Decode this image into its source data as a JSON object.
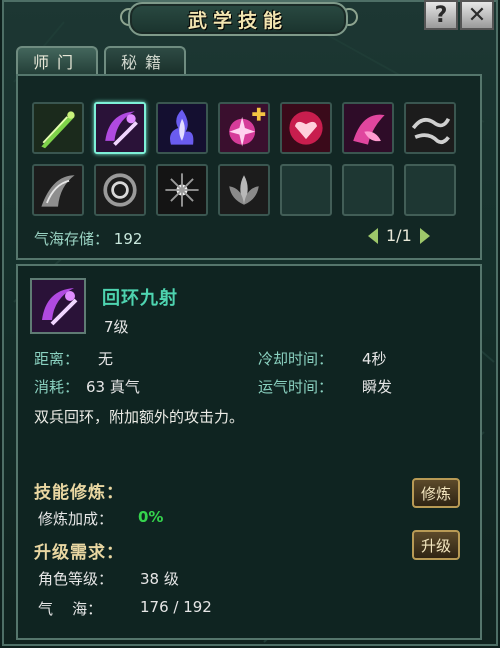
{
  "window": {
    "title": "武学技能",
    "help_label": "?",
    "close_label": "✕"
  },
  "tabs": [
    {
      "label": "师门",
      "active": true
    },
    {
      "label": "秘籍",
      "active": false
    }
  ],
  "skills": [
    {
      "icon": "green-blade-icon",
      "selected": false
    },
    {
      "icon": "purple-crescent-blade-icon",
      "selected": true
    },
    {
      "icon": "blue-purple-flame-icon",
      "selected": false
    },
    {
      "icon": "pink-star-burst-plus-icon",
      "selected": false
    },
    {
      "icon": "crimson-heart-shield-icon",
      "selected": false
    },
    {
      "icon": "magenta-petal-icon",
      "selected": false
    },
    {
      "icon": "grey-dragon-icon",
      "selected": false
    },
    {
      "icon": "grey-swirl-wing-icon",
      "selected": false
    },
    {
      "icon": "grey-vortex-icon",
      "selected": false
    },
    {
      "icon": "grey-sparkle-icon",
      "selected": false
    },
    {
      "icon": "grey-lotus-icon",
      "selected": false
    },
    {
      "icon": "empty-slot",
      "selected": false
    },
    {
      "icon": "empty-slot",
      "selected": false
    },
    {
      "icon": "empty-slot",
      "selected": false
    }
  ],
  "qihai": {
    "label": "气海存储：",
    "value": "192"
  },
  "pager": {
    "current_total": "1/1"
  },
  "detail": {
    "name": "回环九射",
    "level": "7级",
    "range_label": "距离：",
    "range_value": "无",
    "cooldown_label": "冷却时间：",
    "cooldown_value": "4秒",
    "cost_label": "消耗：",
    "cost_value": "63 真气",
    "cast_label": "运气时间：",
    "cast_value": "瞬发",
    "description": "双兵回环，附加额外的攻击力。"
  },
  "training": {
    "heading": "技能修炼：",
    "bonus_label": "修炼加成：",
    "bonus_value": "0%",
    "button_label": "修炼"
  },
  "upgrade": {
    "heading": "升级需求：",
    "level_label": "角色等级：",
    "level_value": "38 级",
    "qi_label": "气    海：",
    "qi_value": "176 / 192",
    "button_label": "升级"
  },
  "colors": {
    "accent_teal": "#4ed4b0",
    "heading_gold": "#e9d7a2",
    "bonus_green": "#35d44d",
    "selected_border": "#7ef0d8"
  }
}
